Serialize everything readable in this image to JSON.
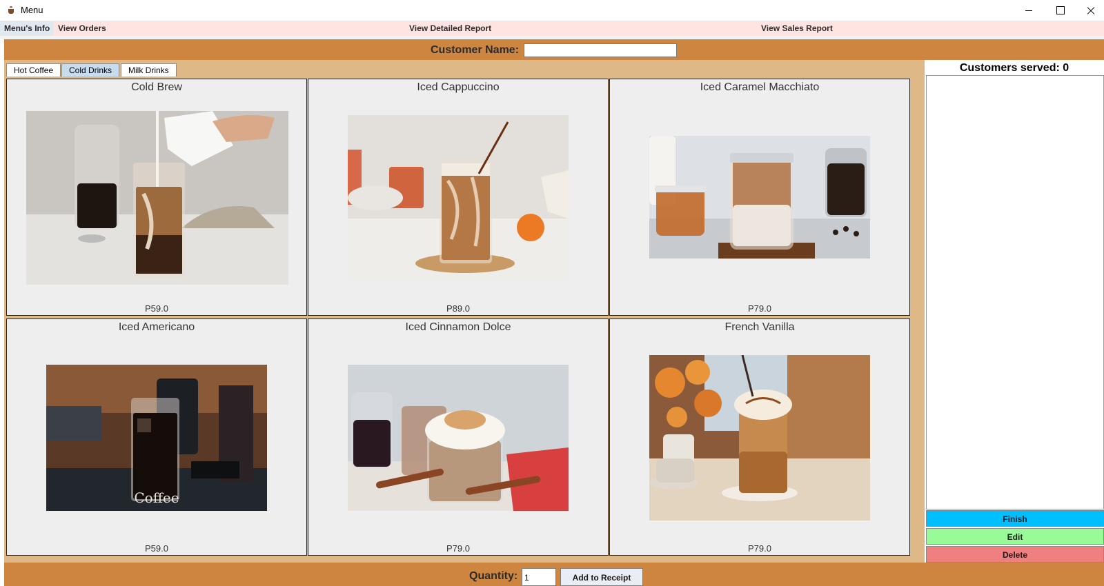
{
  "window": {
    "title": "Menu",
    "icon": "coffee-cup-icon"
  },
  "menubar": {
    "items": [
      {
        "label": "Menu's Info"
      },
      {
        "label": "View Orders"
      },
      {
        "label": "View Detailed Report"
      },
      {
        "label": "View Sales Report"
      }
    ]
  },
  "customer": {
    "label": "Customer Name:",
    "value": ""
  },
  "tabs": [
    {
      "label": "Hot Coffee",
      "active": false
    },
    {
      "label": "Cold Drinks",
      "active": true
    },
    {
      "label": "Milk Drinks",
      "active": false
    }
  ],
  "products": [
    {
      "name": "Cold Brew",
      "price": "P59.0",
      "image": "cold-brew-photo"
    },
    {
      "name": "Iced Cappuccino",
      "price": "P89.0",
      "image": "iced-cappuccino-photo"
    },
    {
      "name": "Iced Caramel Macchiato",
      "price": "P79.0",
      "image": "iced-caramel-macchiato-photo"
    },
    {
      "name": "Iced Americano",
      "price": "P59.0",
      "image": "iced-americano-photo"
    },
    {
      "name": "Iced Cinnamon Dolce",
      "price": "P79.0",
      "image": "iced-cinnamon-dolce-photo"
    },
    {
      "name": "French Vanilla",
      "price": "P79.0",
      "image": "french-vanilla-photo"
    }
  ],
  "right_panel": {
    "served_label": "Customers served: 0",
    "buttons": {
      "finish": "Finish",
      "edit": "Edit",
      "delete": "Delete"
    }
  },
  "bottom": {
    "quantity_label": "Quantity:",
    "quantity_value": "1",
    "add_label": "Add to Receipt"
  },
  "colors": {
    "header_brown": "#cd853f",
    "panel_tan": "#deb887",
    "menubar_pink": "#ffe4e1",
    "finish_blue": "#00bfff",
    "edit_green": "#98fb98",
    "delete_red": "#f08080"
  }
}
